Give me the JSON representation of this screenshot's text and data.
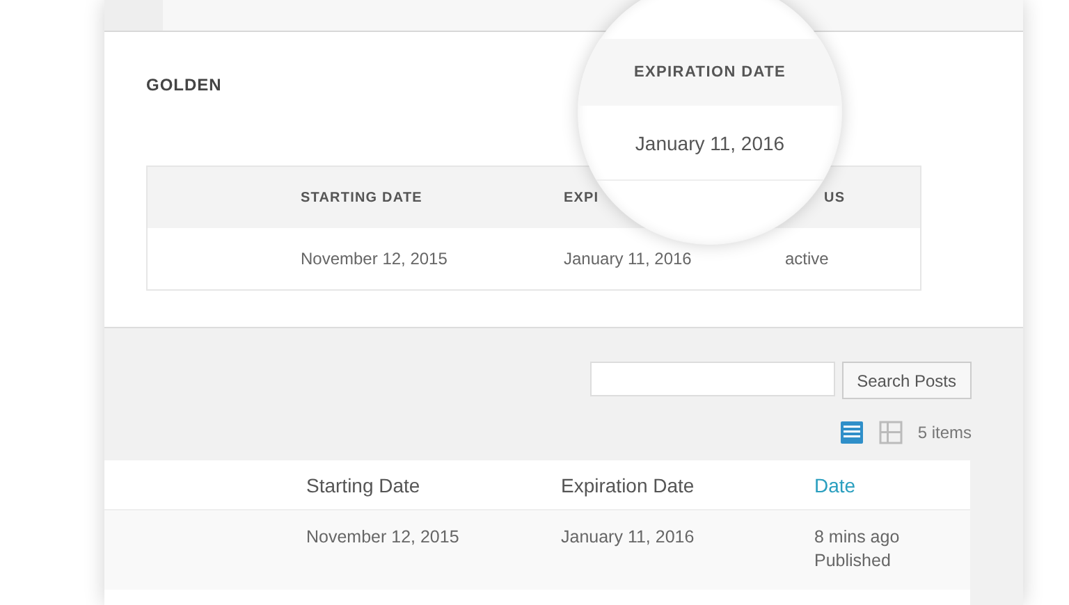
{
  "membership": {
    "name": "GOLDEN",
    "table": {
      "columns": [
        "STARTING DATE",
        "EXPI",
        "US"
      ],
      "rows": [
        [
          "November 12, 2015",
          "January 11, 2016",
          "active"
        ]
      ]
    }
  },
  "magnifier": {
    "heading": "EXPIRATION DATE",
    "value": "January 11, 2016"
  },
  "search": {
    "button": "Search Posts"
  },
  "views": [
    {
      "kind": "list",
      "selected": true
    },
    {
      "kind": "excerpt",
      "selected": false
    }
  ],
  "count": "5 items",
  "posts": {
    "columns": [
      {
        "label": "Starting Date",
        "sortable": false
      },
      {
        "label": "Expiration Date",
        "sortable": false
      },
      {
        "label": "Date",
        "sortable": true
      }
    ],
    "rows": [
      {
        "cells": [
          "November 12, 2015",
          "January 11, 2016"
        ],
        "date": "8 mins ago",
        "status": "Published"
      }
    ]
  }
}
